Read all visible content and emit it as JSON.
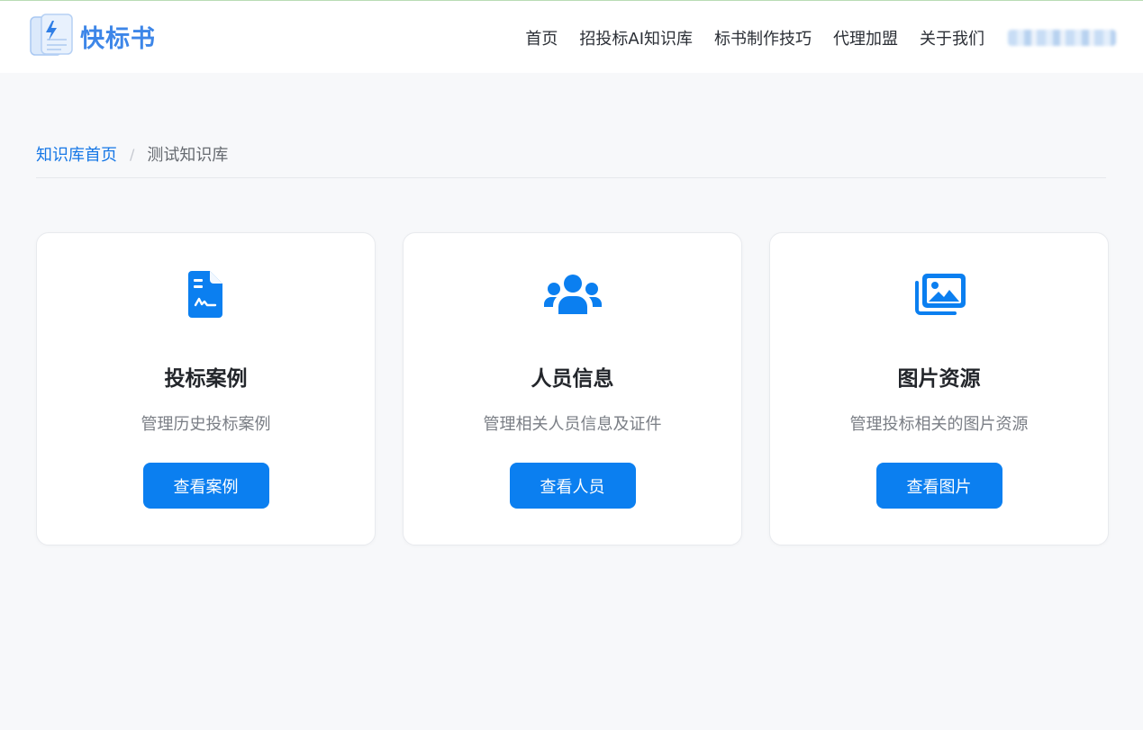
{
  "brand": {
    "name": "快标书",
    "accent": "#3d86e8",
    "logo_icon": "document-lightning-icon"
  },
  "nav": {
    "items": [
      {
        "label": "首页"
      },
      {
        "label": "招投标AI知识库"
      },
      {
        "label": "标书制作技巧"
      },
      {
        "label": "代理加盟"
      },
      {
        "label": "关于我们"
      }
    ]
  },
  "breadcrumb": {
    "home": "知识库首页",
    "separator": "/",
    "current": "测试知识库"
  },
  "cards": [
    {
      "icon": "document-signature-icon",
      "title": "投标案例",
      "desc": "管理历史投标案例",
      "button": "查看案例"
    },
    {
      "icon": "users-icon",
      "title": "人员信息",
      "desc": "管理相关人员信息及证件",
      "button": "查看人员"
    },
    {
      "icon": "images-icon",
      "title": "图片资源",
      "desc": "管理投标相关的图片资源",
      "button": "查看图片"
    }
  ],
  "colors": {
    "primary": "#0b7ff0",
    "link": "#1677e6",
    "background": "#f7f8fa"
  }
}
